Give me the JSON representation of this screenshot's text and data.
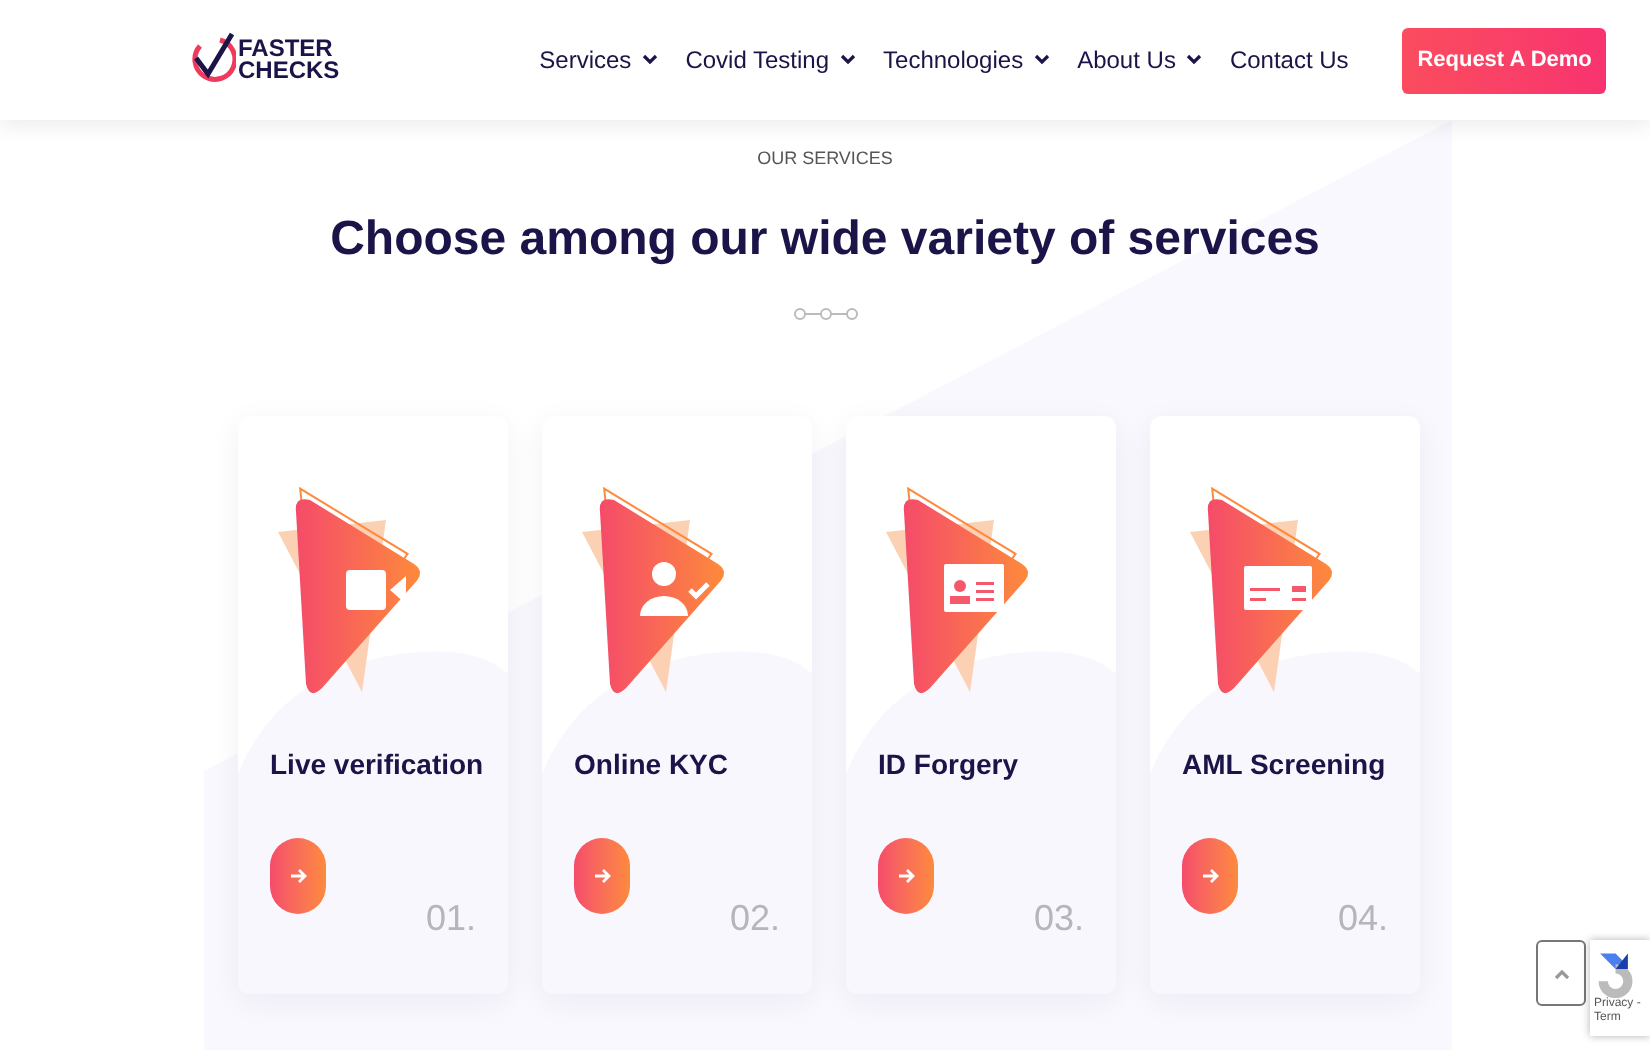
{
  "header": {
    "logo": {
      "line_1": "FASTER",
      "line_2": "CHECKS"
    },
    "nav": [
      {
        "label": "Services",
        "has_dropdown": true
      },
      {
        "label": "Covid Testing",
        "has_dropdown": true
      },
      {
        "label": "Technologies",
        "has_dropdown": true
      },
      {
        "label": "About Us",
        "has_dropdown": true
      },
      {
        "label": "Contact Us",
        "has_dropdown": false
      }
    ],
    "cta": "Request A Demo"
  },
  "section": {
    "eyebrow": "OUR SERVICES",
    "title": "Choose among our wide variety of services"
  },
  "cards": [
    {
      "title": "Live verification",
      "number": "01."
    },
    {
      "title": "Online KYC",
      "number": "02."
    },
    {
      "title": "ID Forgery",
      "number": "03."
    },
    {
      "title": "AML Screening",
      "number": "04."
    }
  ],
  "recaptcha": {
    "text": "Privacy - Term"
  }
}
